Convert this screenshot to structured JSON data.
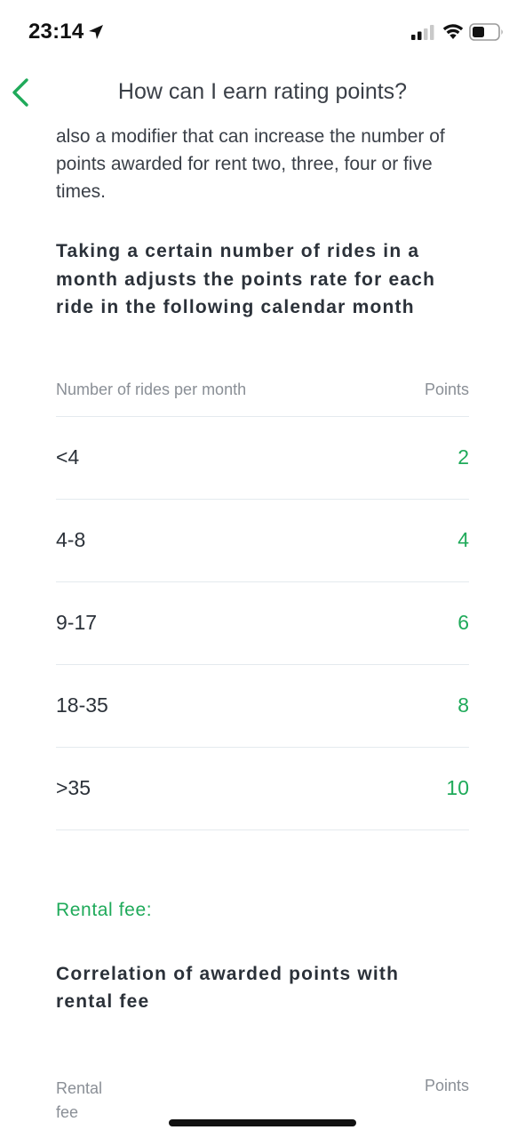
{
  "status_bar": {
    "time": "23:14",
    "location_icon": "location-arrow-icon",
    "signal_icon": "cellular-signal-icon",
    "wifi_icon": "wifi-icon",
    "battery_icon": "battery-icon"
  },
  "nav": {
    "back_icon": "chevron-left-icon",
    "title": "How can I earn rating points?"
  },
  "intro_text": "also a modifier that can increase the number of points awarded for rent two, three, four or five times.",
  "rides_section": {
    "heading": "Taking a certain number of rides in a month adjusts the points rate for each ride in the following calendar month",
    "columns": [
      "Number of rides per month",
      "Points"
    ],
    "rows": [
      {
        "rides": "<4",
        "points": "2"
      },
      {
        "rides": "4-8",
        "points": "4"
      },
      {
        "rides": "9-17",
        "points": "6"
      },
      {
        "rides": "18-35",
        "points": "8"
      },
      {
        "rides": ">35",
        "points": "10"
      }
    ]
  },
  "rental_section": {
    "label": "Rental fee:",
    "heading": "Correlation of awarded points with rental fee",
    "columns": [
      "Rental fee",
      "Points"
    ]
  },
  "colors": {
    "accent": "#1faa5a",
    "text": "#2b3139",
    "muted": "#8a8f96",
    "divider": "#e4eaee"
  }
}
